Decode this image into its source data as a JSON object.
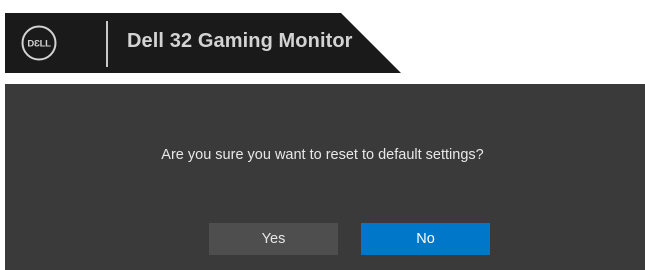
{
  "header": {
    "logo_text": "DELL",
    "title": "Dell 32 Gaming Monitor"
  },
  "dialog": {
    "message": "Are you sure you want to reset to default settings?",
    "yes_label": "Yes",
    "no_label": "No"
  },
  "colors": {
    "header_background": "#1a1a1a",
    "dialog_background": "#3a3a3a",
    "yes_button": "#4e4e4e",
    "no_button_selected": "#0077c8",
    "title_text": "#d3d3d3"
  }
}
